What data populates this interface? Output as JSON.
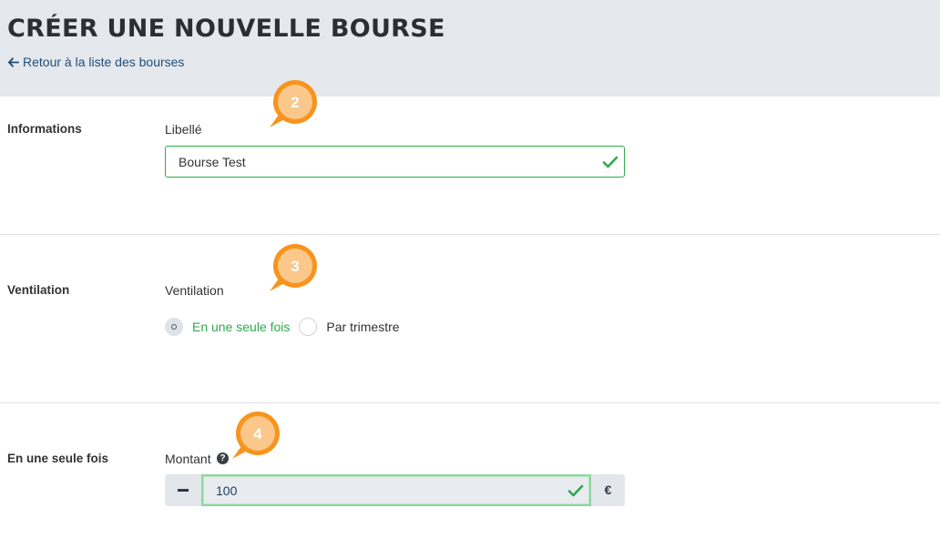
{
  "header": {
    "title": "CRÉER UNE NOUVELLE BOURSE",
    "back_link": "Retour à la liste des bourses"
  },
  "sections": {
    "informations": {
      "label": "Informations",
      "field_label": "Libellé",
      "value": "Bourse Test"
    },
    "ventilation": {
      "label": "Ventilation",
      "field_label": "Ventilation",
      "options": [
        "En une seule fois",
        "Par trimestre"
      ],
      "selected": "En une seule fois"
    },
    "montant": {
      "label": "En une seule fois",
      "field_label": "Montant",
      "value": "100",
      "currency": "€"
    }
  },
  "badges": [
    "2",
    "3",
    "4"
  ],
  "colors": {
    "header_bg": "#e5e8ec",
    "link": "#1f4e79",
    "valid_green": "#2eaa4e",
    "badge_orange": "#f7941d"
  }
}
